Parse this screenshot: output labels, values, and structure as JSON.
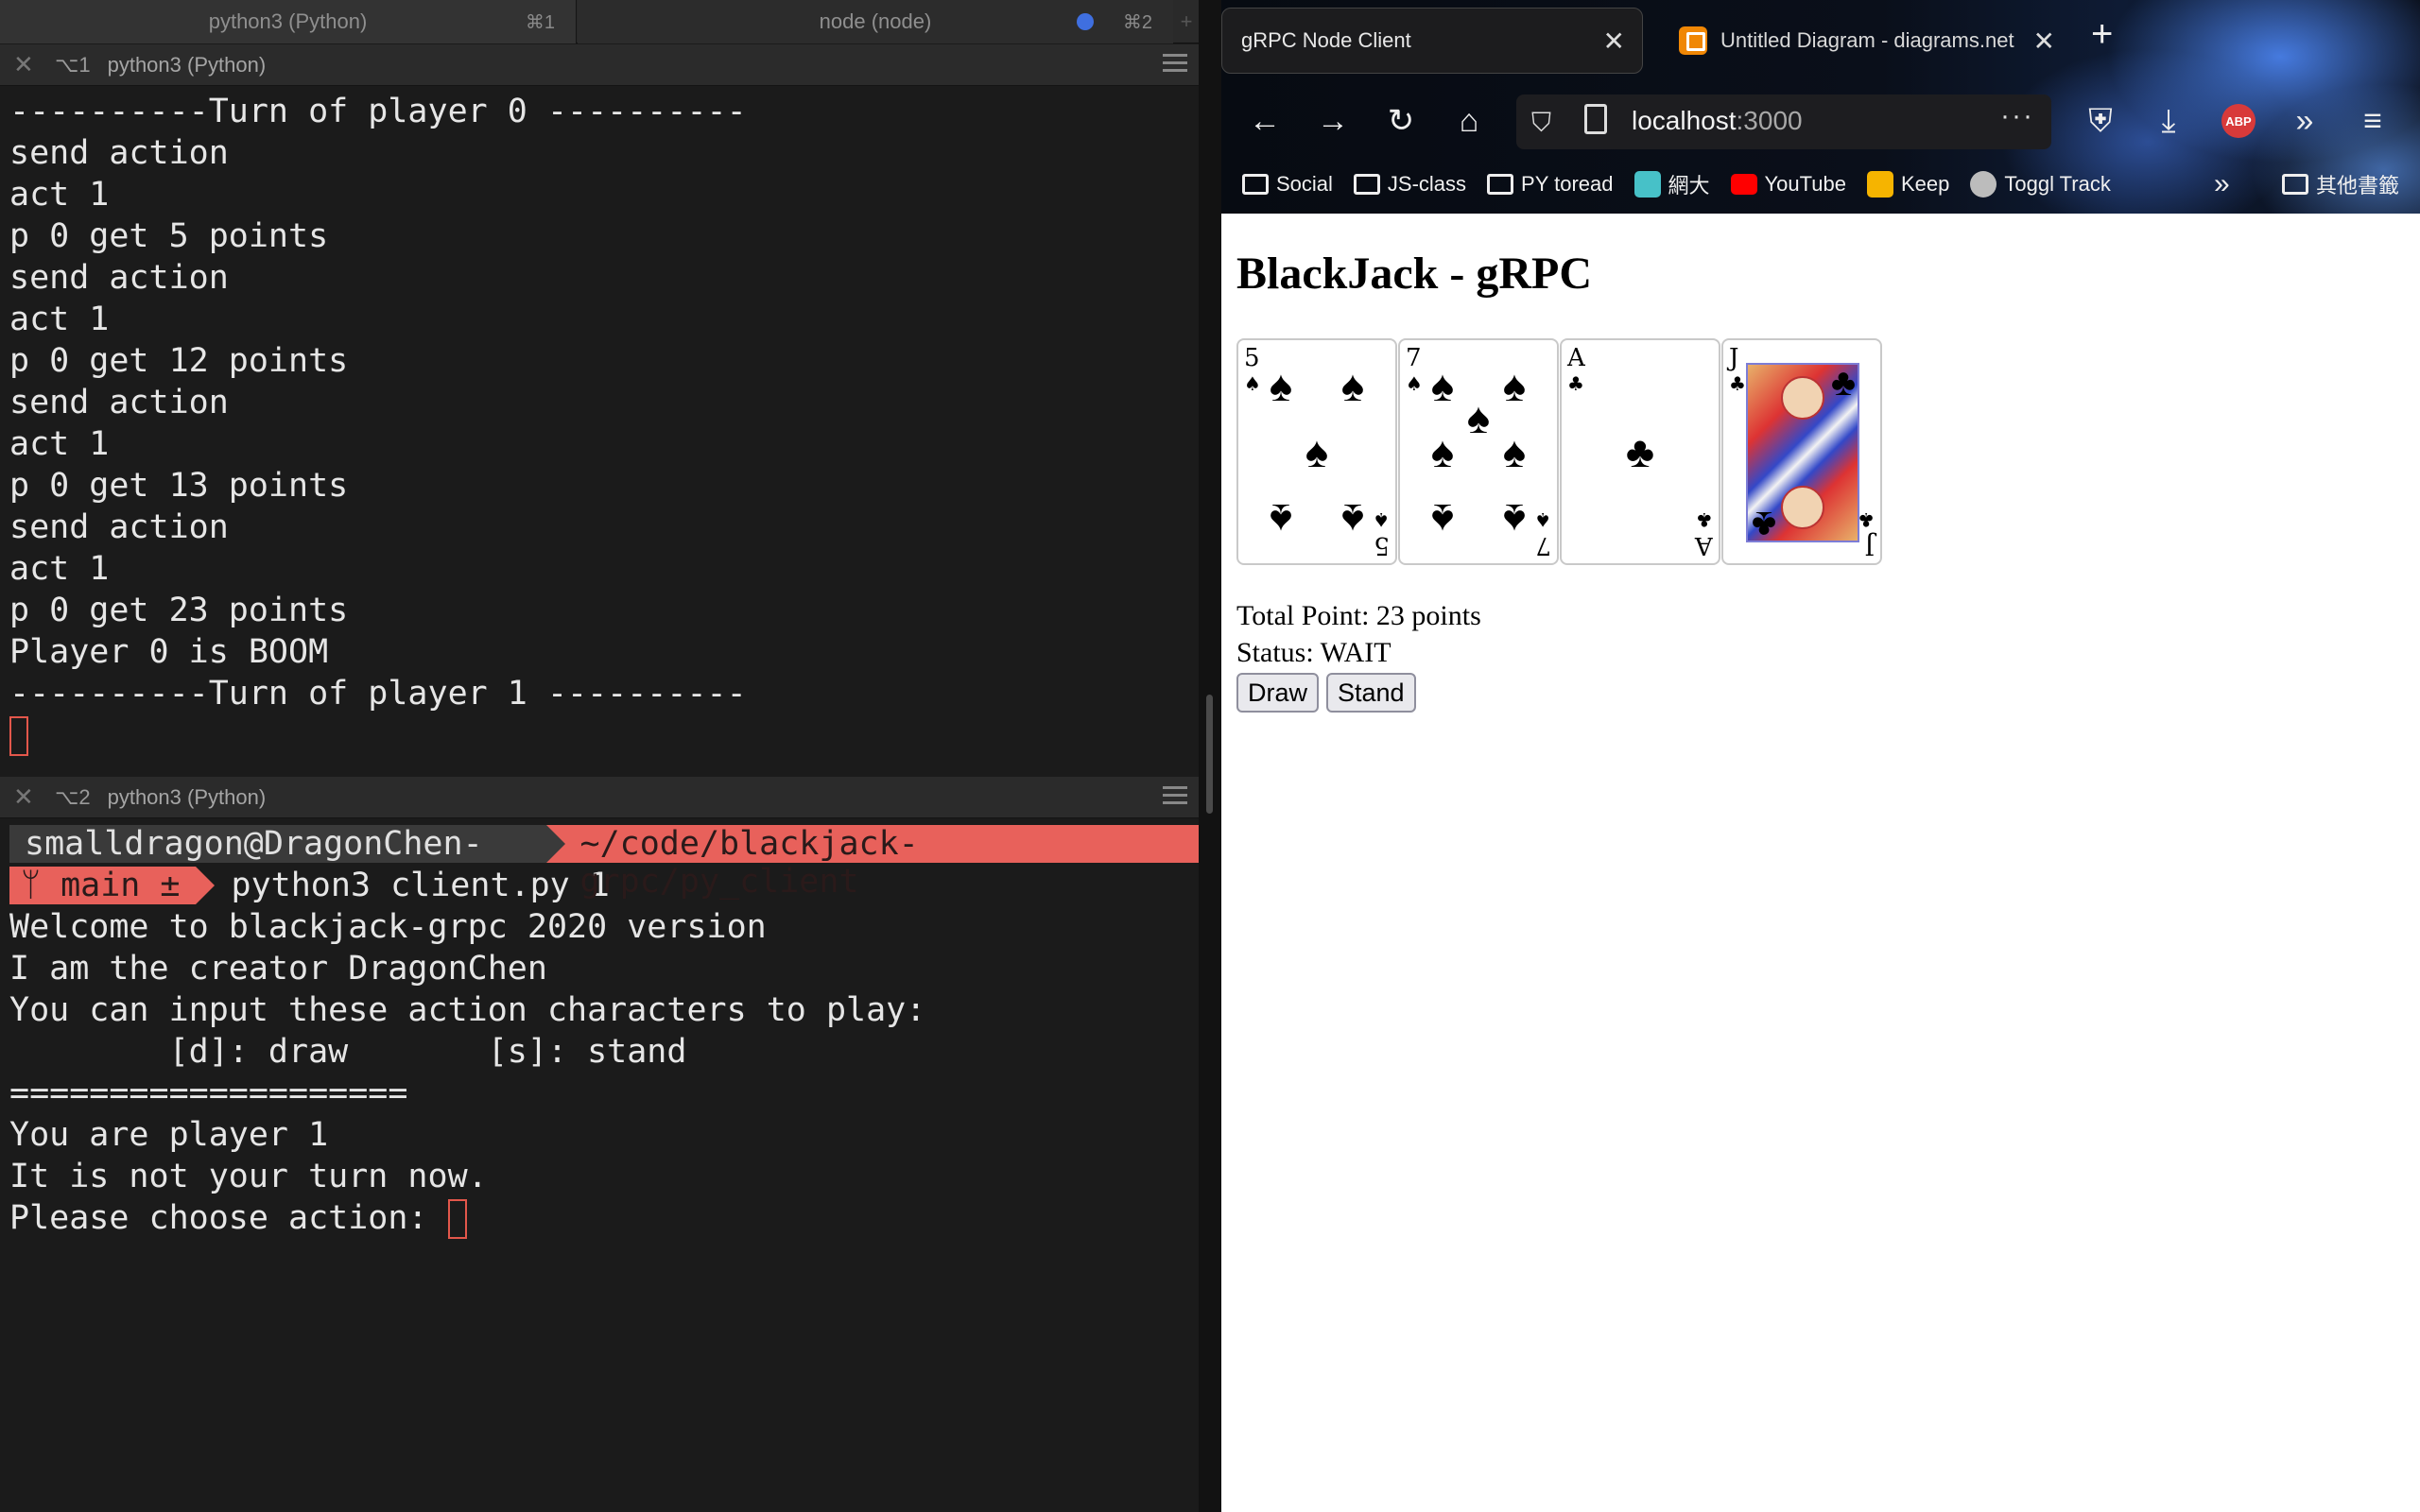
{
  "terminal": {
    "tabs": [
      {
        "label": "python3 (Python)",
        "shortcut": "⌘1"
      },
      {
        "label": "node (node)",
        "shortcut": "⌘2"
      }
    ],
    "pane1": {
      "close": "✕",
      "key": "⌥1",
      "title": "python3 (Python)",
      "lines": [
        "----------Turn of player 0 ----------",
        "send action",
        "act 1",
        "p 0 get 5 points",
        "send action",
        "act 1",
        "p 0 get 12 points",
        "send action",
        "act 1",
        "p 0 get 13 points",
        "send action",
        "act 1",
        "p 0 get 23 points",
        "Player 0 is BOOM",
        "----------Turn of player 1 ----------"
      ]
    },
    "pane2": {
      "close": "✕",
      "key": "⌥2",
      "title": "python3 (Python)",
      "prompt_user": "smalldragon@DragonChen-MBP",
      "prompt_path": "~/code/blackjack-grpc/py_client",
      "prompt_branch": "ᛘ main ±",
      "command": "python3 client.py 1",
      "lines": [
        "Welcome to blackjack-grpc 2020 version",
        "I am the creator DragonChen",
        "You can input these action characters to play:",
        "        [d]: draw       [s]: stand",
        "====================",
        "You are player 1",
        "It is not your turn now."
      ],
      "input_prompt": "Please choose action: "
    }
  },
  "browser": {
    "tabs": [
      {
        "label": "gRPC Node Client",
        "close": "✕"
      },
      {
        "label": "Untitled Diagram - diagrams.net",
        "close": "✕"
      }
    ],
    "new_tab": "+",
    "url_host": "localhost",
    "url_port": ":3000",
    "abp": "ABP",
    "bookmarks": [
      "Social",
      "JS-class",
      "PY toread",
      "網大",
      "YouTube",
      "Keep",
      "Toggl Track"
    ],
    "bookmark_other": "其他書籤",
    "colors": {
      "youtube": "#ff0000",
      "keep": "#f6b400",
      "toggl": "#bcbcbc",
      "m": "#47c1c8"
    }
  },
  "page": {
    "title": "BlackJack - gRPC",
    "cards": [
      {
        "rank": "5",
        "suit": "♠"
      },
      {
        "rank": "7",
        "suit": "♠"
      },
      {
        "rank": "A",
        "suit": "♣"
      },
      {
        "rank": "J",
        "suit": "♣"
      }
    ],
    "total_point": "Total Point: 23 points",
    "status": "Status: WAIT",
    "draw_label": "Draw",
    "stand_label": "Stand"
  }
}
